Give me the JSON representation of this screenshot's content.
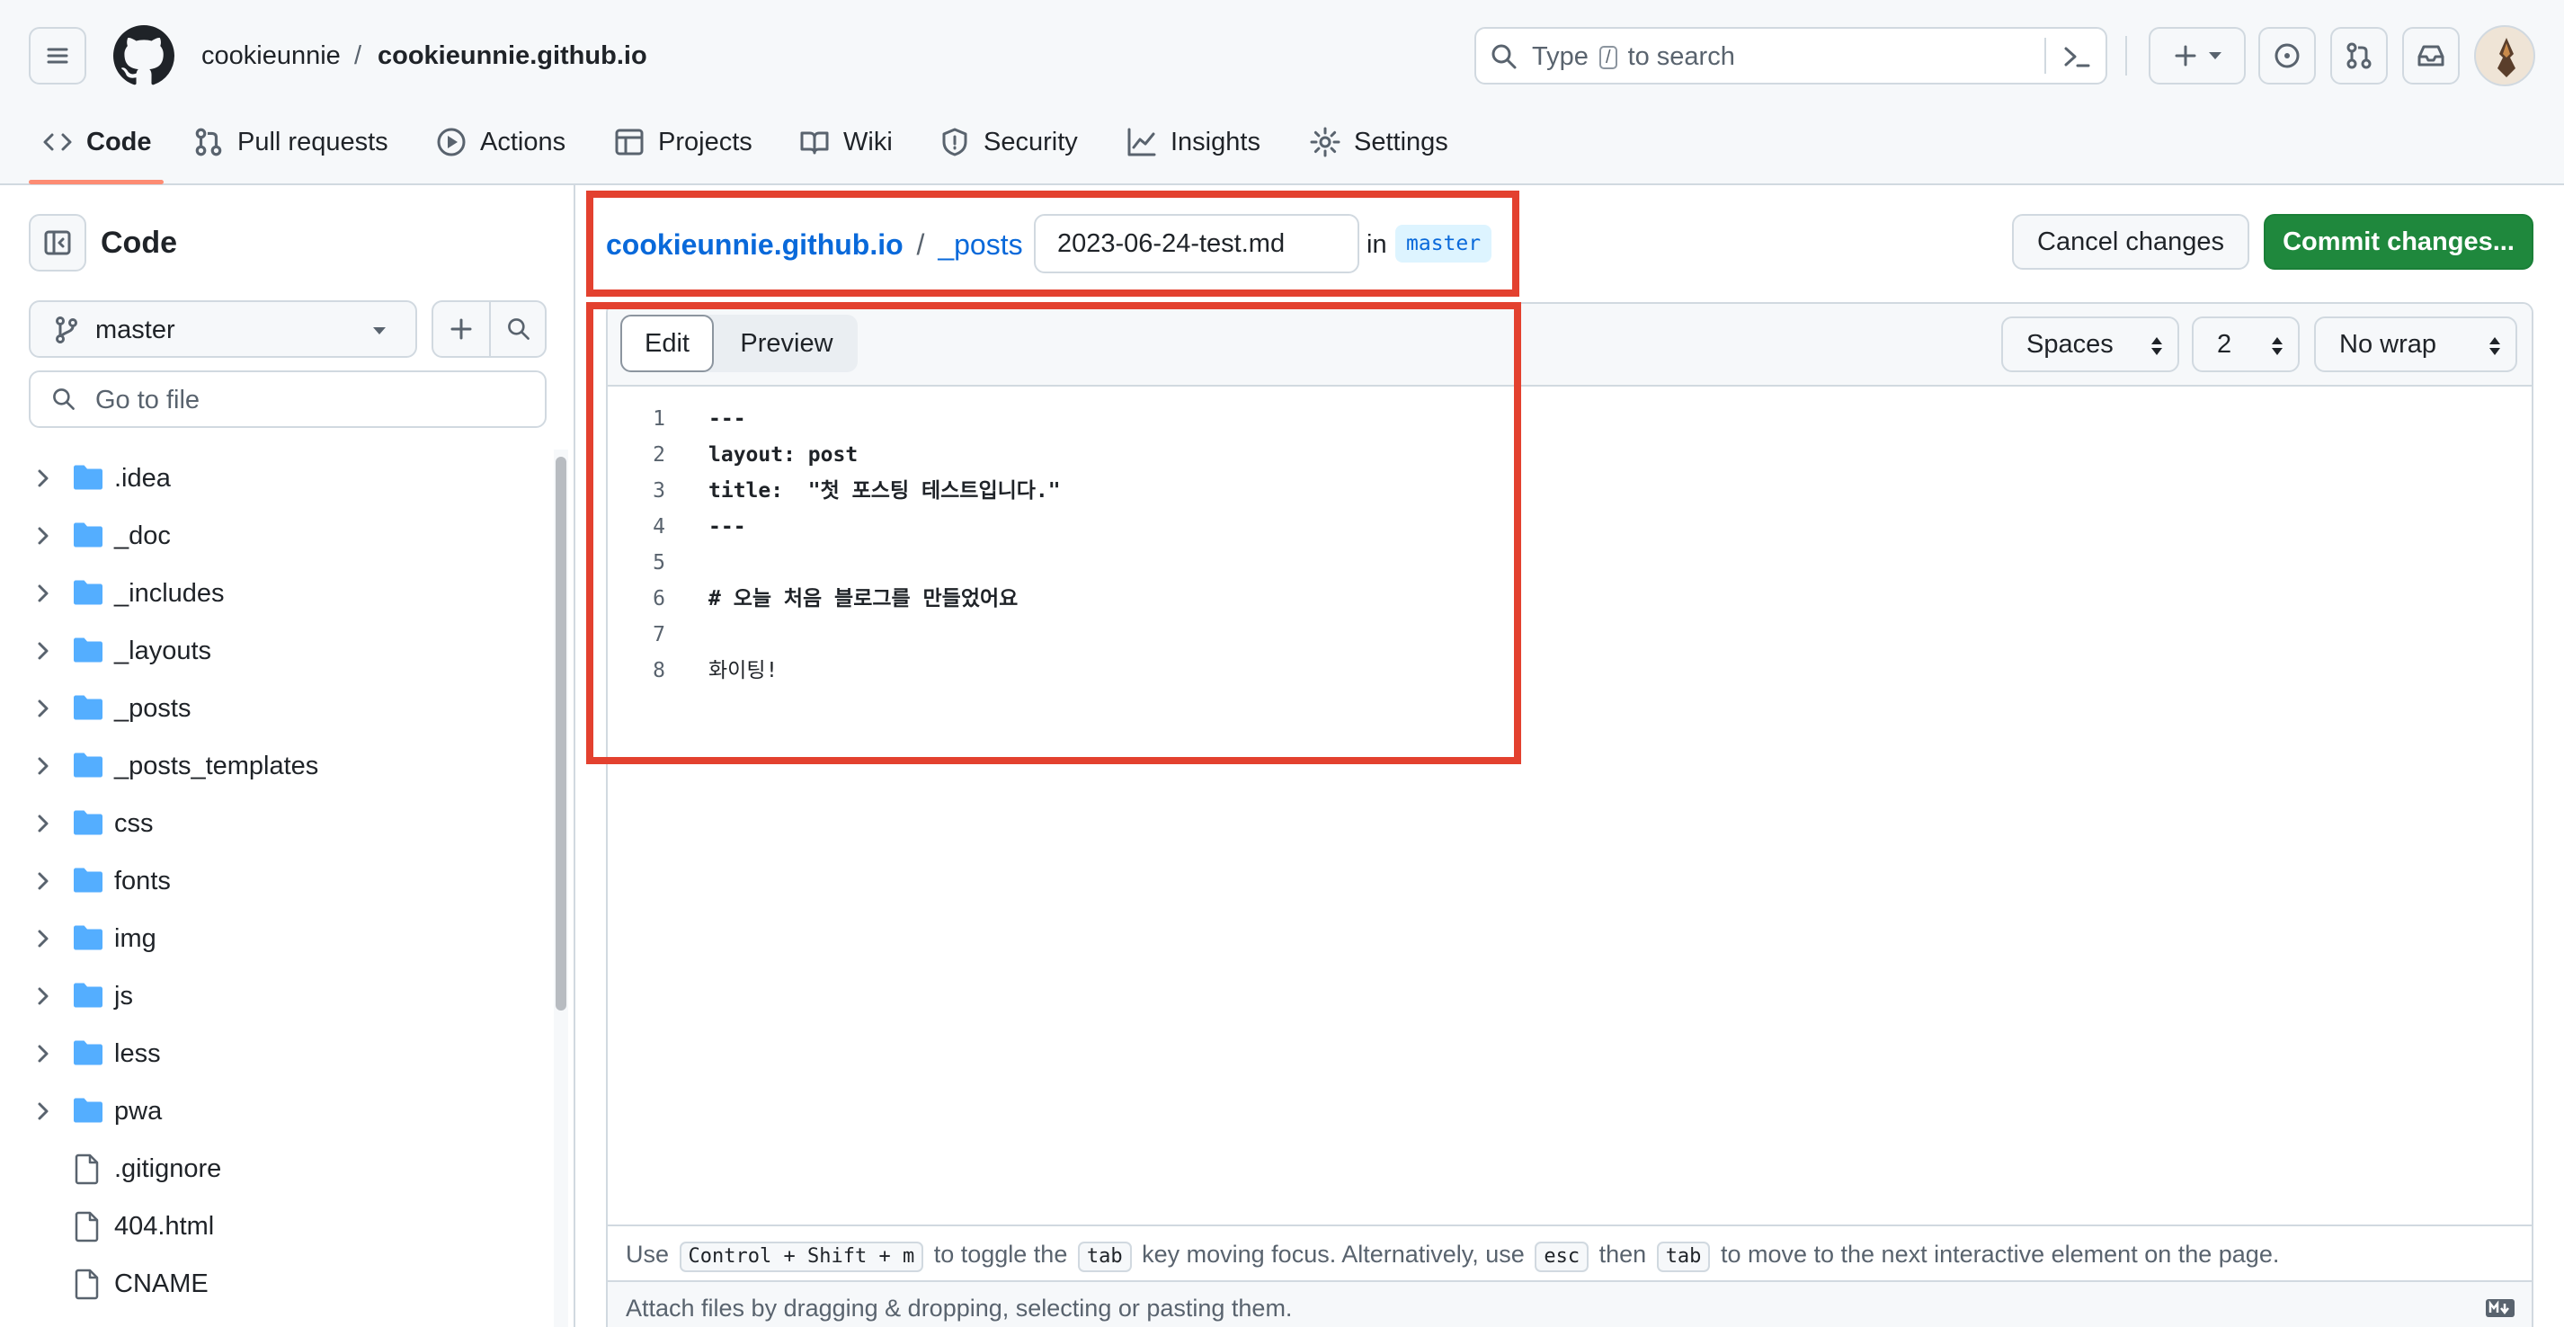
{
  "header": {
    "owner": "cookieunnie",
    "separator": "/",
    "repo": "cookieunnie.github.io",
    "search_type": "Type",
    "search_key": "/",
    "search_rest": "to search"
  },
  "repo_nav": [
    {
      "id": "code",
      "label": "Code",
      "icon": "code-icon"
    },
    {
      "id": "pull-requests",
      "label": "Pull requests",
      "icon": "pull-request-icon"
    },
    {
      "id": "actions",
      "label": "Actions",
      "icon": "play-icon"
    },
    {
      "id": "projects",
      "label": "Projects",
      "icon": "table-icon"
    },
    {
      "id": "wiki",
      "label": "Wiki",
      "icon": "book-icon"
    },
    {
      "id": "security",
      "label": "Security",
      "icon": "shield-icon"
    },
    {
      "id": "insights",
      "label": "Insights",
      "icon": "graph-icon"
    },
    {
      "id": "settings",
      "label": "Settings",
      "icon": "gear-icon"
    }
  ],
  "sidebar": {
    "title": "Code",
    "branch": "master",
    "go_to_file_placeholder": "Go to file",
    "tree": [
      {
        "name": ".idea",
        "type": "folder"
      },
      {
        "name": "_doc",
        "type": "folder"
      },
      {
        "name": "_includes",
        "type": "folder"
      },
      {
        "name": "_layouts",
        "type": "folder"
      },
      {
        "name": "_posts",
        "type": "folder"
      },
      {
        "name": "_posts_templates",
        "type": "folder"
      },
      {
        "name": "css",
        "type": "folder"
      },
      {
        "name": "fonts",
        "type": "folder"
      },
      {
        "name": "img",
        "type": "folder"
      },
      {
        "name": "js",
        "type": "folder"
      },
      {
        "name": "less",
        "type": "folder"
      },
      {
        "name": "pwa",
        "type": "folder"
      },
      {
        "name": ".gitignore",
        "type": "file"
      },
      {
        "name": "404.html",
        "type": "file"
      },
      {
        "name": "CNAME",
        "type": "file"
      }
    ]
  },
  "editor_header": {
    "repo_link": "cookieunnie.github.io",
    "sep1": "/",
    "dir_link": "_posts",
    "sep2": "/",
    "filename": "2023-06-24-test.md",
    "in_label": "in",
    "branch_badge": "master",
    "cancel_label": "Cancel changes",
    "commit_label": "Commit changes..."
  },
  "editor_toolbar": {
    "edit_tab": "Edit",
    "preview_tab": "Preview",
    "indent_mode": "Spaces",
    "indent_size": "2",
    "wrap_mode": "No wrap"
  },
  "code_lines": [
    {
      "n": "1",
      "text": "---",
      "bold": true
    },
    {
      "n": "2",
      "text": "layout: post",
      "bold": true
    },
    {
      "n": "3",
      "text": "title:  \"첫 포스팅 테스트입니다.\"",
      "bold": true
    },
    {
      "n": "4",
      "text": "---",
      "bold": true
    },
    {
      "n": "5",
      "text": "",
      "bold": false
    },
    {
      "n": "6",
      "text": "# 오늘 처음 블로그를 만들었어요",
      "bold": true
    },
    {
      "n": "7",
      "text": "",
      "bold": false
    },
    {
      "n": "8",
      "text": "화이팅!",
      "bold": false
    }
  ],
  "footer": {
    "use": "Use",
    "shortcut": "Control + Shift + m",
    "toggle_the": "to toggle the",
    "tab_key": "tab",
    "moving_focus": "key moving focus. Alternatively, use",
    "esc_key": "esc",
    "then": "then",
    "tab_key2": "tab",
    "to_move": "to move to the next interactive element on the page.",
    "attach": "Attach files by dragging & dropping, selecting or pasting them."
  },
  "colors": {
    "accent_link": "#0969da",
    "primary_button": "#1f883d",
    "highlight_box": "#e3412f",
    "nav_underline": "#fd8c73",
    "folder": "#54aeff"
  }
}
